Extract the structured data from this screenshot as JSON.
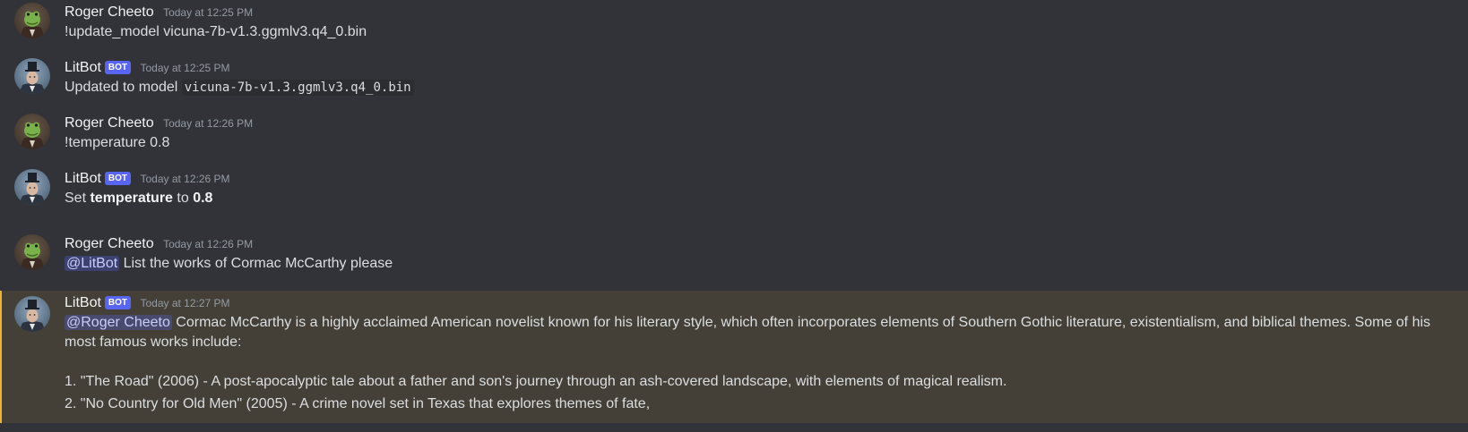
{
  "messages": [
    {
      "author": "Roger Cheeto",
      "timestamp": "Today at 12:25 PM",
      "text": "!update_model vicuna-7b-v1.3.ggmlv3.q4_0.bin"
    },
    {
      "author": "LitBot",
      "bot_tag": "BOT",
      "timestamp": "Today at 12:25 PM",
      "text_prefix": "Updated to model ",
      "code": "vicuna-7b-v1.3.ggmlv3.q4_0.bin"
    },
    {
      "author": "Roger Cheeto",
      "timestamp": "Today at 12:26 PM",
      "text": "!temperature 0.8"
    },
    {
      "author": "LitBot",
      "bot_tag": "BOT",
      "timestamp": "Today at 12:26 PM",
      "text_prefix": "Set ",
      "bold_1": "temperature",
      "text_mid": " to ",
      "bold_2": "0.8"
    },
    {
      "author": "Roger Cheeto",
      "timestamp": "Today at 12:26 PM",
      "mention": "@LitBot",
      "text": " List the works of Cormac McCarthy please"
    },
    {
      "author": "LitBot",
      "bot_tag": "BOT",
      "timestamp": "Today at 12:27 PM",
      "mention": "@Roger Cheeto",
      "text": " Cormac McCarthy is a highly acclaimed American novelist known for his literary style, which often incorporates elements of Southern Gothic literature, existentialism, and biblical themes. Some of his most famous works include:",
      "list": [
        "1. \"The Road\" (2006) - A post-apocalyptic tale about a father and son's journey through an ash-covered landscape, with elements of magical realism.",
        "2. \"No Country for Old Men\" (2005) - A crime novel set in Texas that explores themes of fate,"
      ]
    }
  ],
  "colors": {
    "background": "#313338",
    "highlight_background": "#444037",
    "highlight_bar": "#f0b232",
    "bot_tag": "#5865f2",
    "mention_text": "#c9cdfb"
  },
  "icons": {
    "user_avatar": "frog-avatar-icon",
    "bot_avatar": "gentleman-top-hat-avatar-icon"
  }
}
